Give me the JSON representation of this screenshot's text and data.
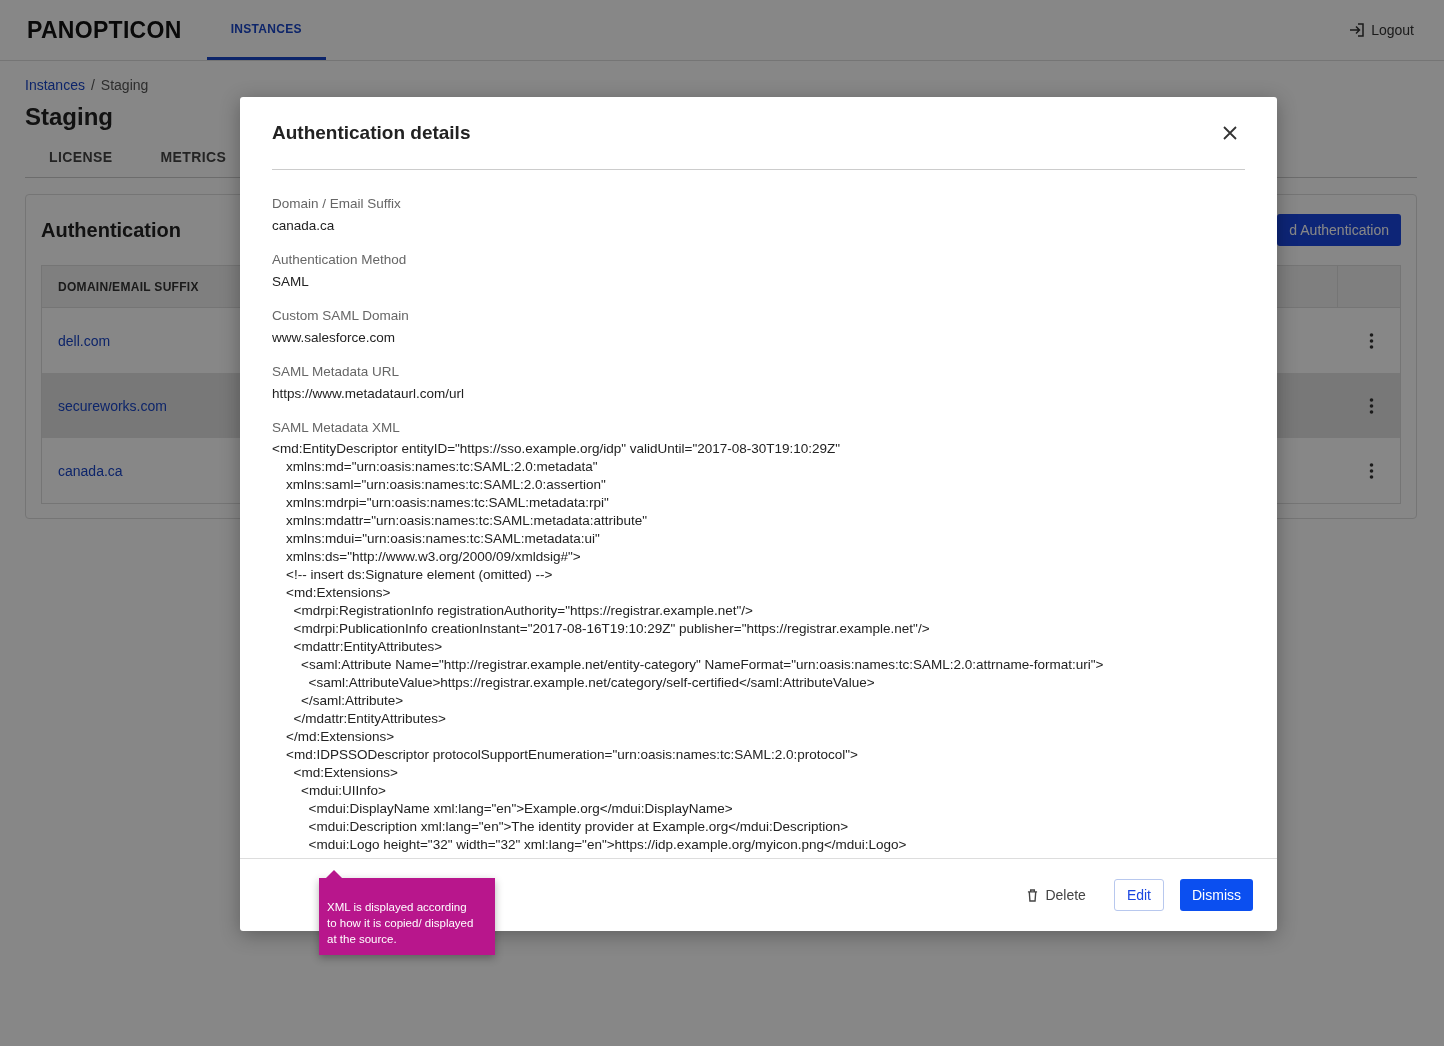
{
  "header": {
    "logo": "PANOPTICON",
    "nav": [
      {
        "label": "INSTANCES",
        "selected": true
      }
    ],
    "logout": "Logout"
  },
  "breadcrumb": {
    "items": [
      {
        "label": "Instances",
        "kind": "link"
      },
      {
        "label": "Staging",
        "kind": "current"
      }
    ],
    "separator": "/"
  },
  "page_title": "Staging",
  "page_tabs": [
    "LICENSE",
    "METRICS"
  ],
  "auth_card": {
    "title": "Authentication",
    "add_button": "d Authentication",
    "columns": [
      "DOMAIN/EMAIL SUFFIX"
    ],
    "rows": [
      {
        "domain": "dell.com",
        "highlighted": false
      },
      {
        "domain": "secureworks.com",
        "highlighted": true
      },
      {
        "domain": "canada.ca",
        "highlighted": false
      }
    ]
  },
  "modal": {
    "title": "Authentication details",
    "fields": [
      {
        "label": "Domain / Email Suffix",
        "value": "canada.ca"
      },
      {
        "label": "Authentication Method",
        "value": "SAML"
      },
      {
        "label": "Custom SAML Domain",
        "value": "www.salesforce.com"
      },
      {
        "label": "SAML Metadata URL",
        "value": "https://www.metadataurl.com/url"
      }
    ],
    "xml_label": "SAML Metadata XML",
    "xml": [
      {
        "text": "<md:EntityDescriptor entityID=\"https://sso.example.org/idp\" validUntil=\"2017-08-30T19:10:29Z\"",
        "children": [
          {
            "text": "xmlns:md=\"urn:oasis:names:tc:SAML:2.0:metadata\""
          },
          {
            "text": "xmlns:saml=\"urn:oasis:names:tc:SAML:2.0:assertion\""
          },
          {
            "text": "xmlns:mdrpi=\"urn:oasis:names:tc:SAML:metadata:rpi\""
          },
          {
            "text": "xmlns:mdattr=\"urn:oasis:names:tc:SAML:metadata:attribute\""
          },
          {
            "text": "xmlns:mdui=\"urn:oasis:names:tc:SAML:metadata:ui\""
          },
          {
            "text": "xmlns:ds=\"http://www.w3.org/2000/09/xmldsig#\">"
          },
          {
            "text": "<!-- insert ds:Signature element (omitted) -->"
          },
          {
            "text": "<md:Extensions>",
            "children": [
              {
                "text": "<mdrpi:RegistrationInfo registrationAuthority=\"https://registrar.example.net\"/>"
              },
              {
                "text": "<mdrpi:PublicationInfo creationInstant=\"2017-08-16T19:10:29Z\" publisher=\"https://registrar.example.net\"/>"
              },
              {
                "text": "<mdattr:EntityAttributes>",
                "children": [
                  {
                    "text": "<saml:Attribute Name=\"http://registrar.example.net/entity-category\" NameFormat=\"urn:oasis:names:tc:SAML:2.0:attrname-format:uri\">",
                    "children": [
                      {
                        "text": "<saml:AttributeValue>https://registrar.example.net/category/self-certified</saml:AttributeValue>"
                      }
                    ]
                  },
                  {
                    "text": "</saml:Attribute>"
                  }
                ]
              },
              {
                "text": "</mdattr:EntityAttributes>"
              }
            ]
          },
          {
            "text": "</md:Extensions>"
          },
          {
            "text": "<md:IDPSSODescriptor protocolSupportEnumeration=\"urn:oasis:names:tc:SAML:2.0:protocol\">",
            "children": [
              {
                "text": "<md:Extensions>",
                "children": [
                  {
                    "text": "<mdui:UIInfo>",
                    "children": [
                      {
                        "text": "<mdui:DisplayName xml:lang=\"en\">Example.org</mdui:DisplayName>"
                      },
                      {
                        "text": "<mdui:Description xml:lang=\"en\">The identity provider at Example.org</mdui:Description>"
                      },
                      {
                        "text": "<mdui:Logo height=\"32\" width=\"32\" xml:lang=\"en\">https://idp.example.org/myicon.png</mdui:Logo>"
                      }
                    ]
                  }
                ]
              }
            ]
          }
        ]
      }
    ],
    "buttons": [
      {
        "label": "Delete",
        "kind": "text"
      },
      {
        "label": "Edit",
        "kind": "outline"
      },
      {
        "label": "Dismiss",
        "kind": "primary"
      }
    ],
    "tooltip": "XML is displayed according to how it is copied/ displayed at the source."
  }
}
